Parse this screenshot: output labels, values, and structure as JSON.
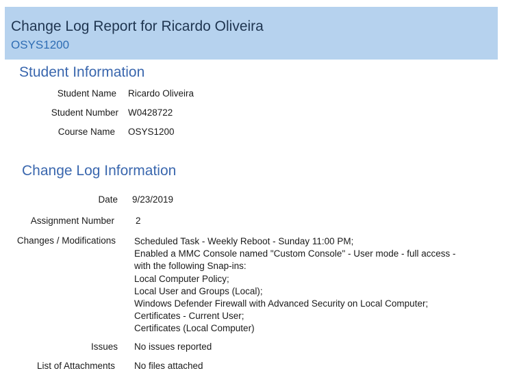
{
  "header": {
    "title": "Change Log Report for Ricardo Oliveira",
    "subtitle": "OSYS1200"
  },
  "student_info": {
    "heading": "Student Information",
    "student_name_label": "Student Name",
    "student_name": "Ricardo Oliveira",
    "student_number_label": "Student Number",
    "student_number": "W0428722",
    "course_name_label": "Course Name",
    "course_name": "OSYS1200"
  },
  "change_log": {
    "heading": "Change Log Information",
    "date_label": "Date",
    "date": "9/23/2019",
    "assignment_label": "Assignment Number",
    "assignment": "2",
    "changes_label": "Changes / Modifications",
    "changes": [
      "Scheduled Task - Weekly Reboot - Sunday 11:00 PM;",
      "Enabled a MMC Console named \"Custom Console\" - User mode - full access -",
      "with the following Snap-ins:",
      "Local Computer Policy;",
      "Local User and Groups (Local);",
      "Windows Defender Firewall with Advanced Security on Local Computer;",
      "Certificates - Current User;",
      "Certificates (Local Computer)"
    ],
    "issues_label": "Issues",
    "issues": "No issues reported",
    "attachments_label": "List of Attachments",
    "attachments": "No files attached"
  }
}
